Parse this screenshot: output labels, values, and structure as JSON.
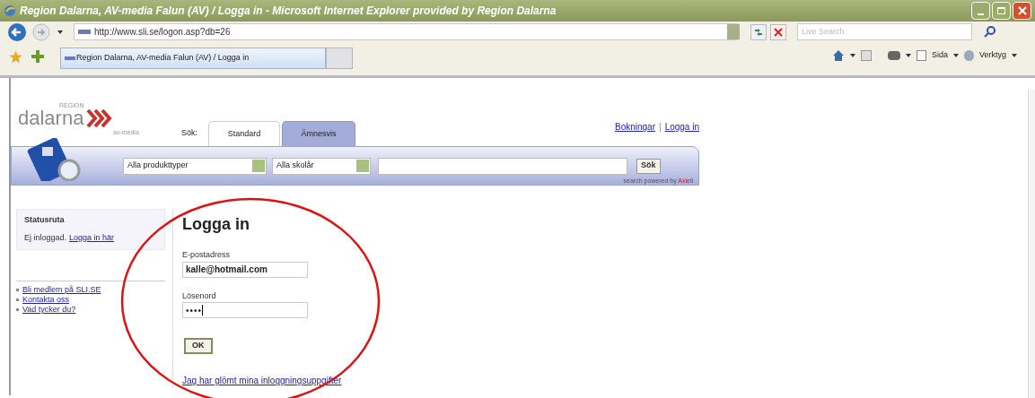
{
  "window": {
    "title": "Region Dalarna, AV-media Falun (AV) / Logga in - Microsoft Internet Explorer provided by Region Dalarna"
  },
  "address_bar": {
    "value": "http://www.sli.se/logon.asp?db=26"
  },
  "search_box": {
    "placeholder": "Live Search"
  },
  "tab": {
    "label": "Region Dalarna, AV-media Falun (AV) / Logga in"
  },
  "toolbar": [
    {
      "label": "Sida"
    },
    {
      "label": "Verktyg"
    }
  ],
  "logo": {
    "small_top": "REGION",
    "name": "dalarna",
    "small_bottom": "av-media"
  },
  "search_tabs": {
    "label": "Sök:",
    "tabs": [
      {
        "label": "Standard",
        "selected": true
      },
      {
        "label": "Ämnesvis",
        "selected": false
      }
    ]
  },
  "top_links": [
    {
      "label": "Bokningar"
    },
    {
      "label": "Logga in"
    }
  ],
  "top_links_separator": "|",
  "search": {
    "selects": [
      "Alla produkttyper",
      "Alla skolår"
    ],
    "button": "Sök",
    "powered_by": "search powered by",
    "powered_brand": "Axiell"
  },
  "status_box": {
    "title": "Statusruta",
    "text": "Ej inloggad.",
    "link": "Logga in här"
  },
  "side_links": [
    "Bli medlem på SLI.SE",
    "Kontakta oss",
    "Vad tycker du?"
  ],
  "login": {
    "heading": "Logga in",
    "fields": [
      {
        "label": "E-postadress",
        "value": "kalle@hotmail.com",
        "kind": "text"
      },
      {
        "label": "Lösenord",
        "value": "••••",
        "kind": "password"
      }
    ],
    "button": "OK",
    "forgot_link": "Jag har glömt mina inloggningsuppgifter"
  }
}
